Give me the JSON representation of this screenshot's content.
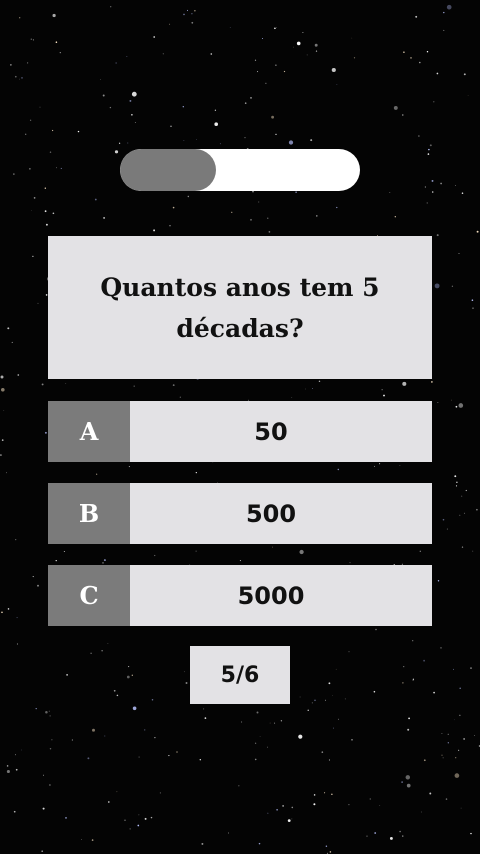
{
  "progress": {
    "fraction": 0.4
  },
  "question": {
    "text": "Quantos anos tem 5 décadas?"
  },
  "options": [
    {
      "letter": "A",
      "value": "50"
    },
    {
      "letter": "B",
      "value": "500"
    },
    {
      "letter": "C",
      "value": "5000"
    }
  ],
  "counter": {
    "text": "5/6"
  },
  "colors": {
    "background": "#040404",
    "card": "#e3e2e5",
    "letter_box": "#7b7b7b",
    "progress_fill": "#7a7a7a",
    "progress_track": "#ffffff"
  }
}
